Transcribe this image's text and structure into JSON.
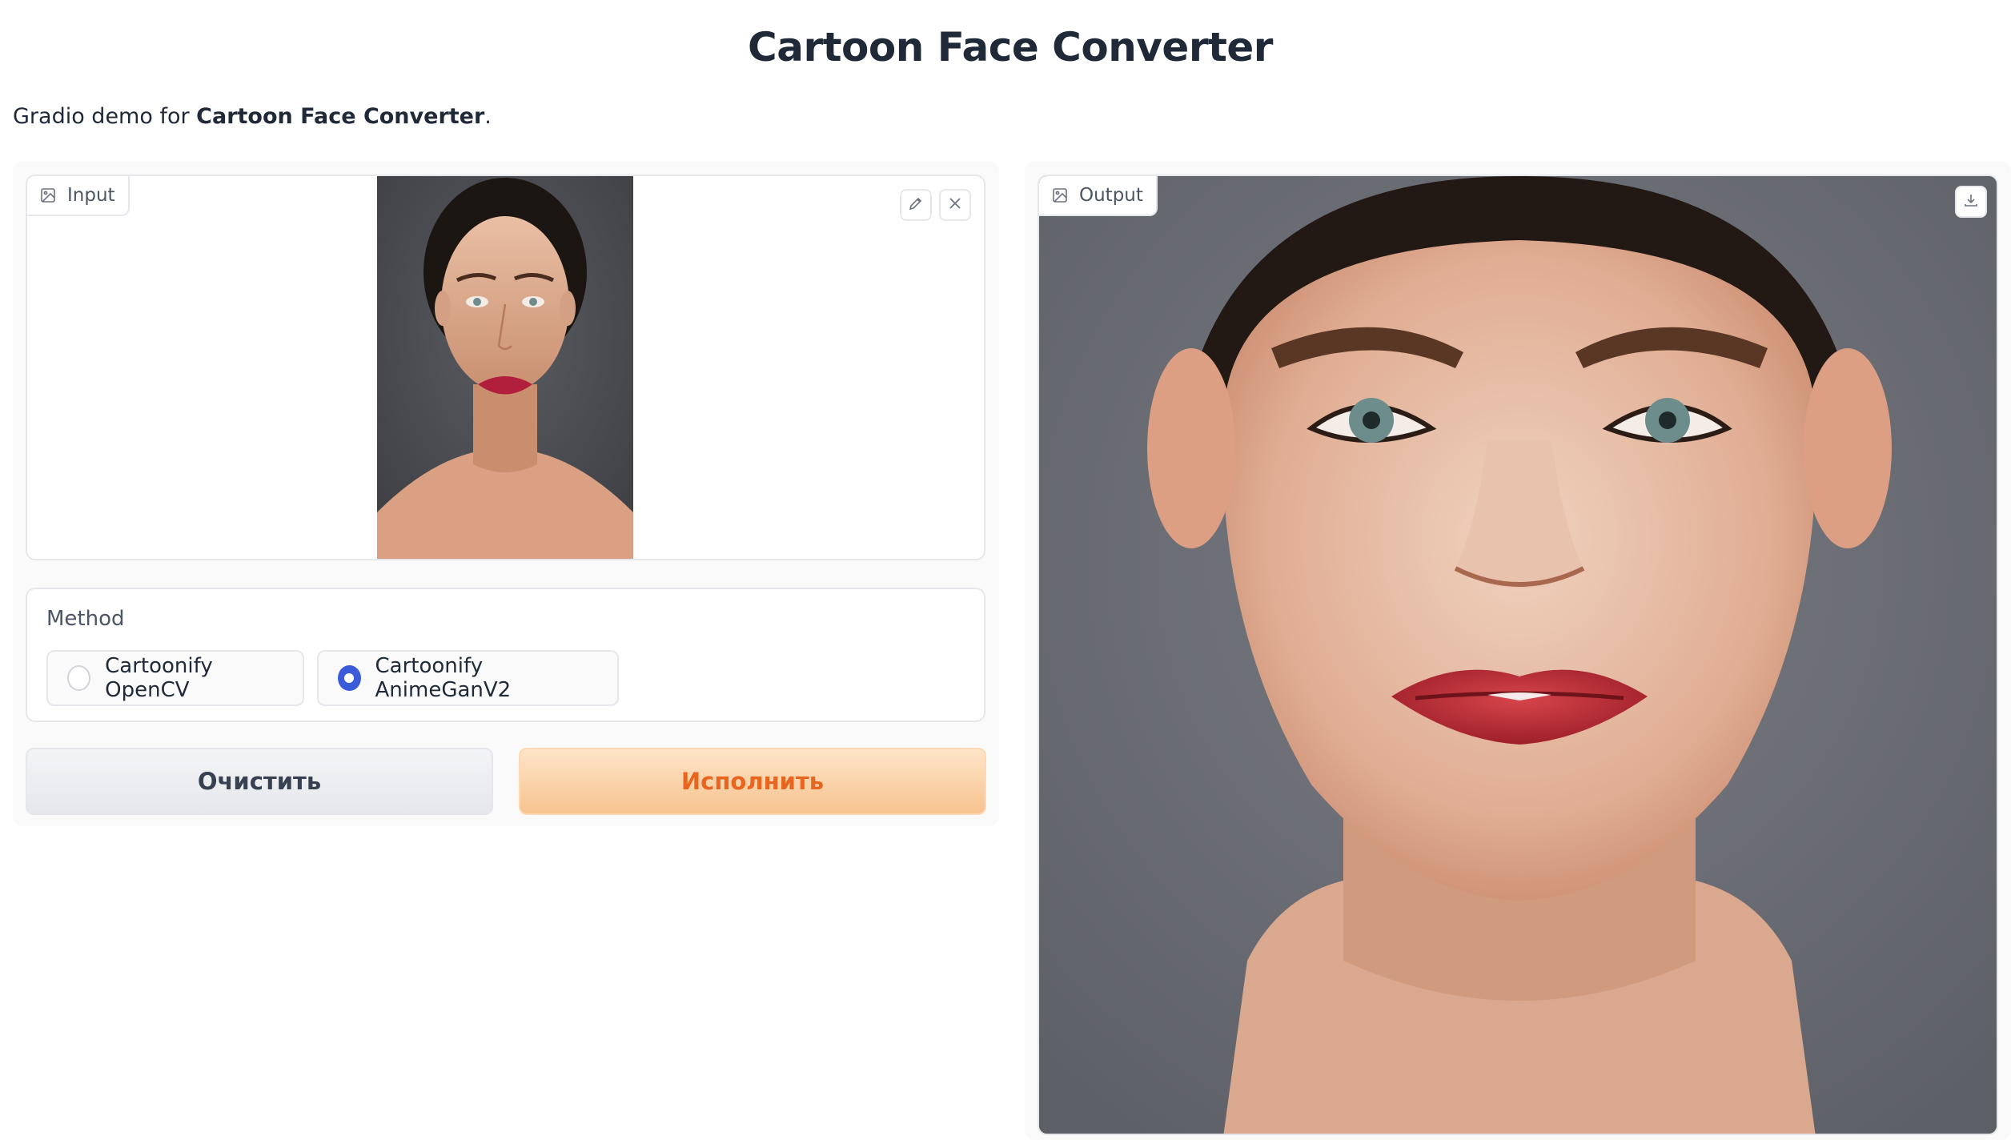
{
  "header": {
    "title": "Cartoon Face Converter",
    "description_prefix": "Gradio demo for ",
    "description_bold": "Cartoon Face Converter",
    "description_suffix": "."
  },
  "input": {
    "label": "Input",
    "icons": [
      "image-icon",
      "pencil-icon",
      "close-icon"
    ]
  },
  "method": {
    "label": "Method",
    "options": [
      "Cartoonify OpenCV",
      "Cartoonify AnimeGanV2"
    ],
    "selected": "Cartoonify AnimeGanV2"
  },
  "buttons": {
    "clear": "Очистить",
    "run": "Исполнить"
  },
  "output": {
    "label": "Output",
    "icons": [
      "image-icon",
      "download-icon"
    ]
  },
  "colors": {
    "accent_radio": "#3b5bdb",
    "run_text": "#e8651f",
    "run_bg": "#f7c38f"
  }
}
